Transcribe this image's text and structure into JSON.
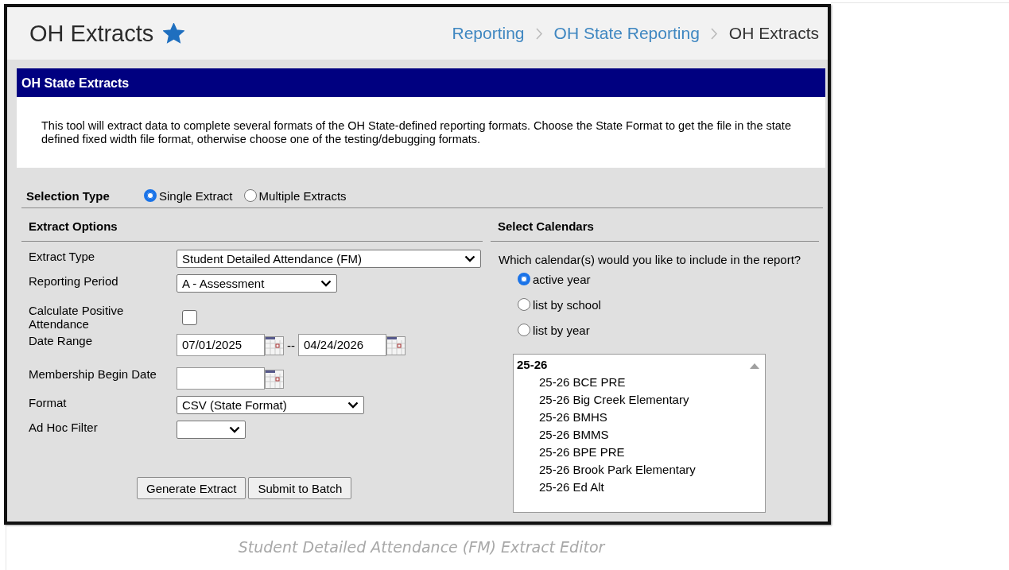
{
  "page_header": {
    "title": "OH Extracts",
    "favorite": true,
    "breadcrumbs": [
      {
        "label": "Reporting",
        "current": false
      },
      {
        "label": "OH State Reporting",
        "current": false
      },
      {
        "label": "OH Extracts",
        "current": true
      }
    ]
  },
  "panel": {
    "title": "OH State Extracts",
    "description": "This tool will extract data to complete several formats of the OH State-defined reporting formats. Choose the State Format to get the file in the state defined fixed width file format, otherwise choose one of the testing/debugging formats."
  },
  "selection_type": {
    "label": "Selection Type",
    "options": [
      {
        "label": "Single Extract",
        "selected": true
      },
      {
        "label": "Multiple Extracts",
        "selected": false
      }
    ]
  },
  "extract_options": {
    "heading": "Extract Options",
    "fields": [
      {
        "kind": "select",
        "label": "Extract Type",
        "value": "Student Detailed Attendance (FM)"
      },
      {
        "kind": "select",
        "label": "Reporting Period",
        "value": "A - Assessment"
      },
      {
        "kind": "checkbox",
        "label": "Calculate Positive Attendance",
        "checked": false
      },
      {
        "kind": "date_range",
        "label": "Date Range",
        "start": "07/01/2025",
        "separator": "--",
        "end": "04/24/2026"
      },
      {
        "kind": "date",
        "label": "Membership Begin Date"
      },
      {
        "kind": "select",
        "label": "Format",
        "value": "CSV (State Format)"
      },
      {
        "kind": "select",
        "label": "Ad Hoc Filter"
      }
    ],
    "buttons": [
      "Generate Extract",
      "Submit to Batch"
    ]
  },
  "select_calendars": {
    "heading": "Select Calendars",
    "question": "Which calendar(s) would you like to include in the report?",
    "options": [
      {
        "label": "active year",
        "selected": true
      },
      {
        "label": "list by school",
        "selected": false
      },
      {
        "label": "list by year",
        "selected": false
      }
    ],
    "calendar_list": [
      {
        "label": "25-26",
        "children": [
          {
            "label": "25-26 BCE PRE"
          },
          {
            "label": "25-26 Big Creek Elementary"
          },
          {
            "label": "25-26 BMHS"
          },
          {
            "label": "25-26 BMMS"
          },
          {
            "label": "25-26 BPE PRE"
          },
          {
            "label": "25-26 Brook Park Elementary"
          },
          {
            "label": "25-26 Ed Alt"
          }
        ]
      }
    ]
  },
  "caption": "Student Detailed Attendance (FM) Extract Editor"
}
